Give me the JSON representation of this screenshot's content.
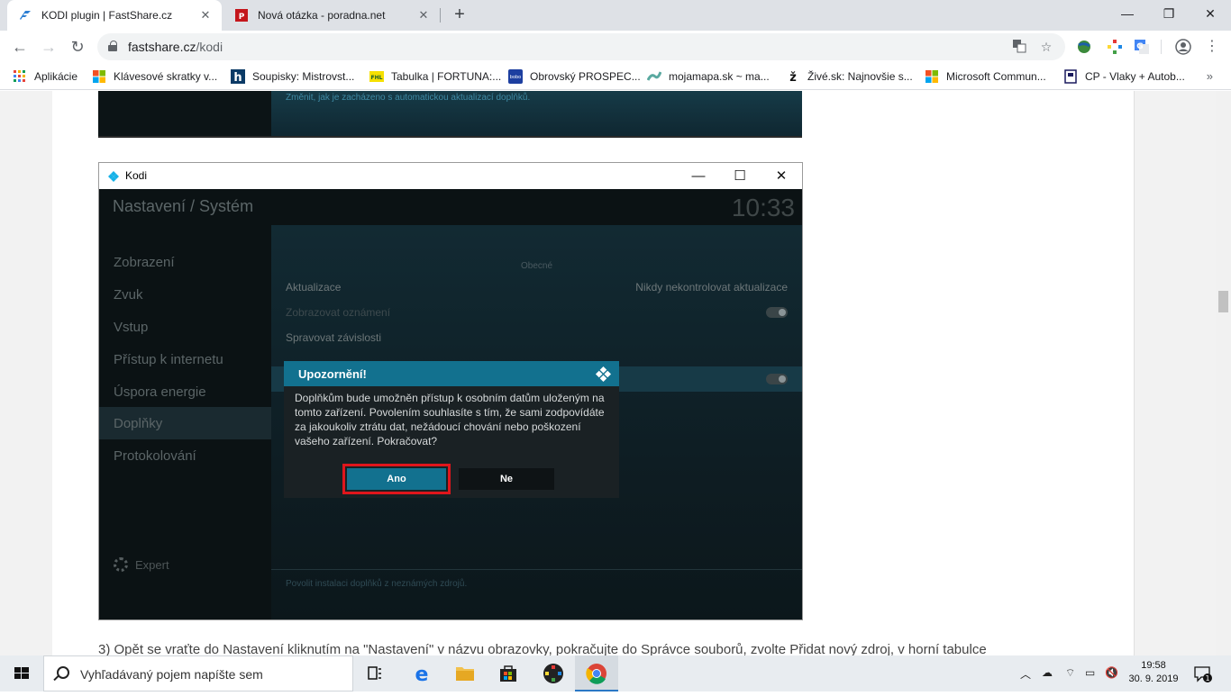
{
  "browser": {
    "tabs": [
      {
        "title": "KODI plugin | FastShare.cz",
        "active": true
      },
      {
        "title": "Nová otázka - poradna.net",
        "active": false
      }
    ],
    "new_tab": "+",
    "url_host": "fastshare.cz",
    "url_path": "/kodi",
    "bookmarks": [
      {
        "label": "Aplikácie",
        "icon": "apps-grid-icon"
      },
      {
        "label": "Klávesové skratky v...",
        "icon": "microsoft-icon"
      },
      {
        "label": "Soupisky: Mistrovst...",
        "icon": "h-logo-icon"
      },
      {
        "label": "Tabulka | FORTUNA:...",
        "icon": "fortuna-icon"
      },
      {
        "label": "Obrovský PROSPEC...",
        "icon": "bobo-icon"
      },
      {
        "label": "mojamapa.sk ~ ma...",
        "icon": "map-icon"
      },
      {
        "label": "Živé.sk: Najnovšie s...",
        "icon": "zive-icon"
      },
      {
        "label": "Microsoft Commun...",
        "icon": "microsoft-icon"
      },
      {
        "label": "CP - Vlaky + Autob...",
        "icon": "cp-icon"
      }
    ],
    "bookmarks_more": "»"
  },
  "page": {
    "top_image_caption": "Změnit, jak je zacházeno s automatickou aktualizací doplňků.",
    "paragraph": "3) Opět se vraťte do Nastavení kliknutím na \"Nastavení\" v názvu obrazovky, pokračujte do Správce souborů, zvolte Přidat nový zdroj, v horní tabulce"
  },
  "kodi": {
    "window_title": "Kodi",
    "heading": "Nastavení / Systém",
    "clock": "10:33",
    "menu": [
      "Zobrazení",
      "Zvuk",
      "Vstup",
      "Přístup k internetu",
      "Úspora energie",
      "Doplňky",
      "Protokolování"
    ],
    "selected_menu": "Doplňky",
    "expert": "Expert",
    "section": "Obecné",
    "settings": [
      {
        "label": "Aktualizace",
        "value": "Nikdy nekontrolovat aktualizace"
      },
      {
        "label": "Zobrazovat oznámení",
        "value": ""
      },
      {
        "label": "Spravovat závislosti",
        "value": ""
      }
    ],
    "footer_hint": "Povolit instalaci doplňků z neznámých zdrojů."
  },
  "dialog": {
    "title": "Upozornění!",
    "message": "Doplňkům bude umožněn přístup k osobním datům uloženým na tomto zařízení. Povolením souhlasíte s tím, že sami zodpovídáte za jakoukoliv ztrátu dat, nežádoucí chování nebo poškození vašeho zařízení. Pokračovat?",
    "yes": "Ano",
    "no": "Ne",
    "highlight_color": "#e0161c"
  },
  "taskbar": {
    "search_placeholder": "Vyhľadávaný pojem napíšte sem",
    "time": "19:58",
    "date": "30. 9. 2019",
    "notifications": "1"
  },
  "colors": {
    "kodi_accent": "#12718f",
    "kodi_bg": "#0b1214"
  }
}
